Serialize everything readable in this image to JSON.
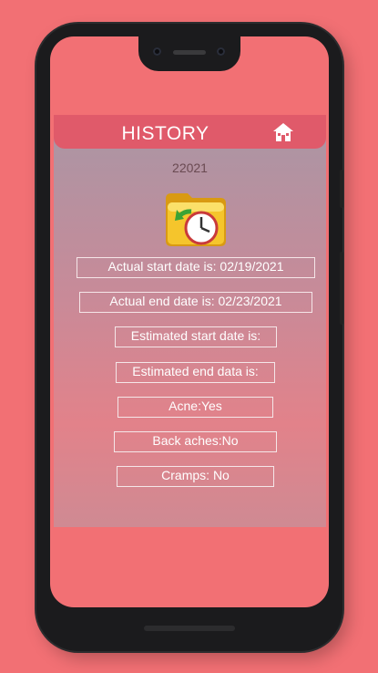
{
  "colors": {
    "background": "#f27074",
    "appbar": "#e05a6a",
    "field_border": "#f5e6e8",
    "text_light": "#ffffff"
  },
  "header": {
    "title": "HISTORY",
    "home_icon": "home-icon"
  },
  "record": {
    "year": "22021",
    "icon": "history-folder-clock-icon",
    "fields": [
      "Actual start date is: 02/19/2021",
      "Actual end date is: 02/23/2021",
      "Estimated start date is:",
      "Estimated end data is:",
      "Acne:Yes",
      "Back aches:No",
      "Cramps: No"
    ]
  }
}
